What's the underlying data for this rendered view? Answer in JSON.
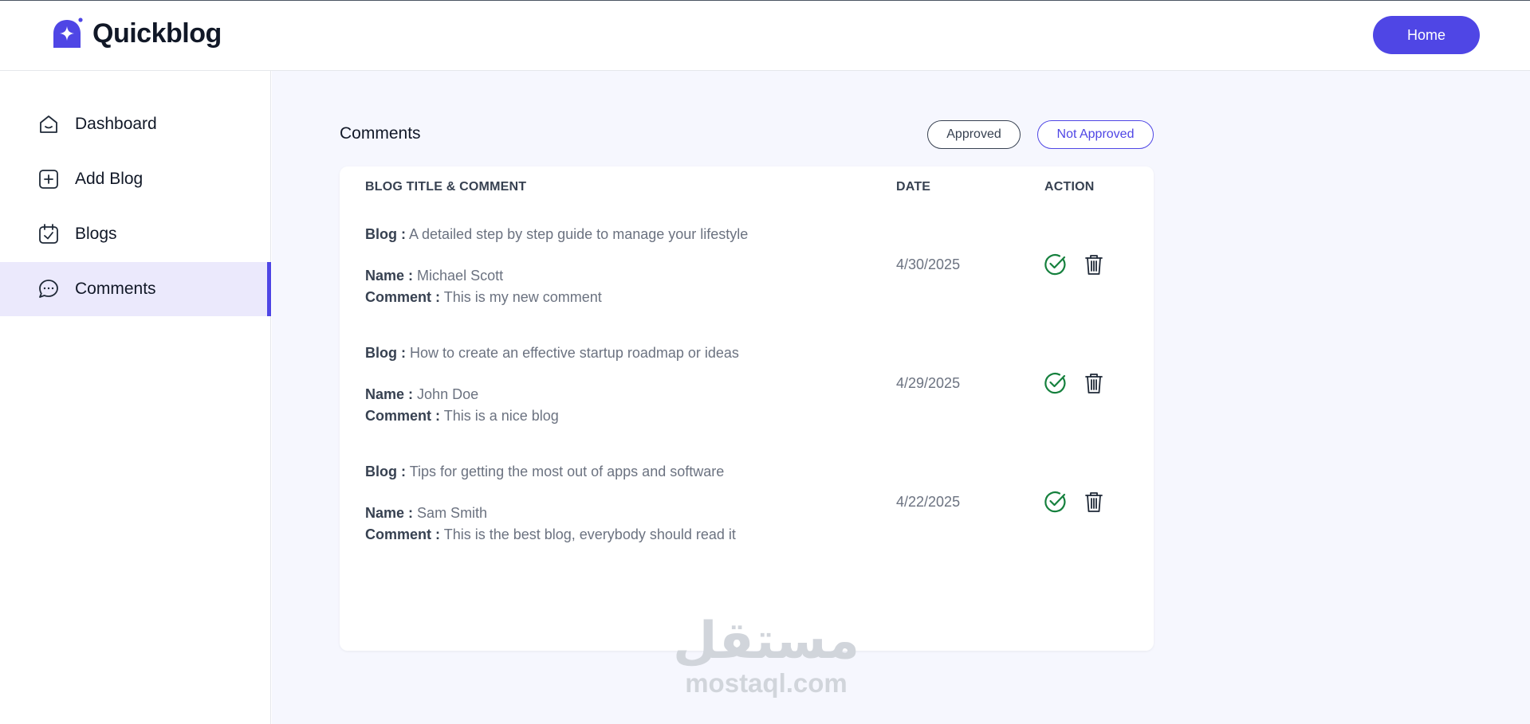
{
  "header": {
    "logo_text": "Quickblog",
    "home_label": "Home"
  },
  "sidebar": {
    "items": [
      {
        "label": "Dashboard",
        "icon": "home-icon",
        "active": false
      },
      {
        "label": "Add Blog",
        "icon": "add-square-icon",
        "active": false
      },
      {
        "label": "Blogs",
        "icon": "calendar-check-icon",
        "active": false
      },
      {
        "label": "Comments",
        "icon": "chat-bubble-icon",
        "active": true
      }
    ]
  },
  "main": {
    "title": "Comments",
    "filters": {
      "approved": "Approved",
      "not_approved": "Not Approved"
    },
    "table": {
      "headers": {
        "title": "BLOG TITLE & COMMENT",
        "date": "DATE",
        "action": "ACTION"
      },
      "labels": {
        "blog": "Blog",
        "name": "Name",
        "comment": "Comment"
      },
      "rows": [
        {
          "blog": "A detailed step by step guide to manage your lifestyle",
          "name": "Michael Scott",
          "comment": "This is my new comment",
          "date": "4/30/2025"
        },
        {
          "blog": "How to create an effective startup roadmap or ideas",
          "name": "John Doe",
          "comment": "This is a nice blog",
          "date": "4/29/2025"
        },
        {
          "blog": "Tips for getting the most out of apps and software",
          "name": "Sam Smith",
          "comment": "This is the best blog, everybody should read it",
          "date": "4/22/2025"
        }
      ]
    }
  },
  "watermark": {
    "arabic": "مستقل",
    "latin": "mostaql.com"
  },
  "colors": {
    "accent": "#4f46e5",
    "active_bg": "#ebe9fc",
    "approve": "#15803d",
    "main_bg": "#f6f7fe"
  }
}
